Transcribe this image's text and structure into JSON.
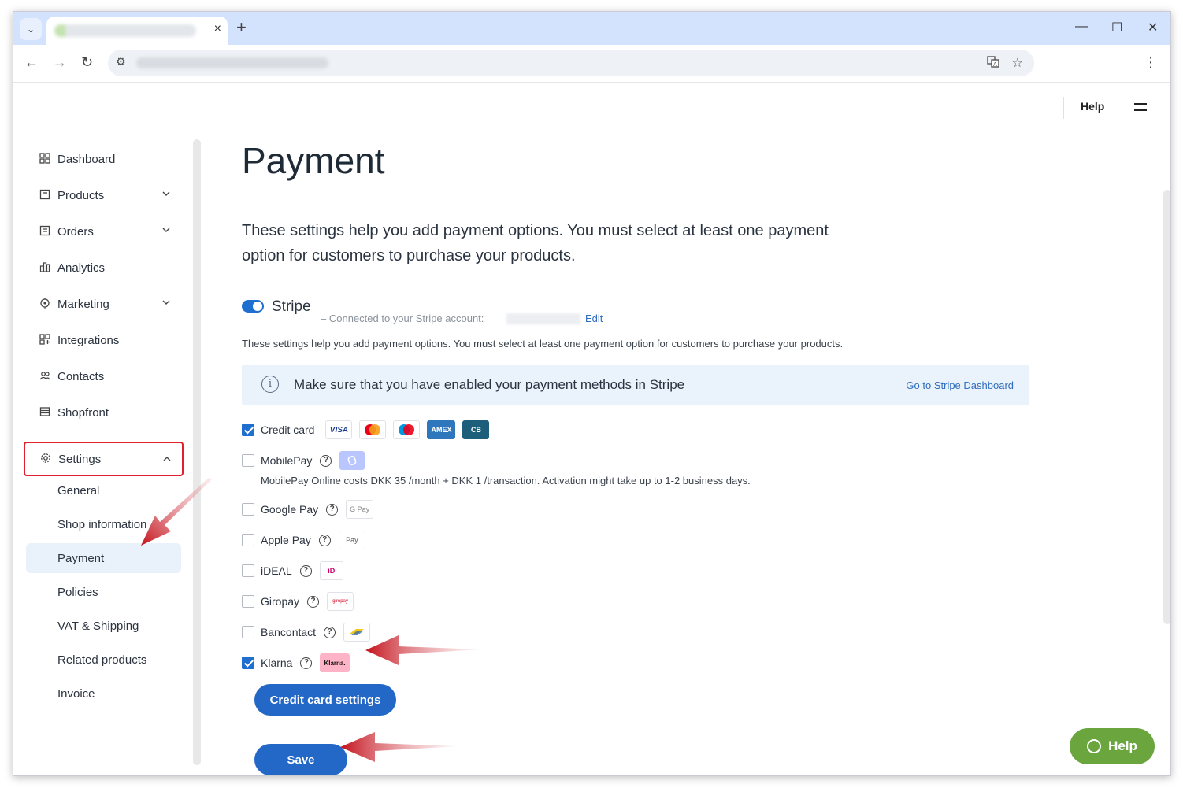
{
  "browser": {
    "tab_close": "×",
    "new_tab": "+",
    "min": "—",
    "max": "☐",
    "close": "✕",
    "back": "←",
    "forward": "→",
    "reload": "↻",
    "menu": "⋮"
  },
  "header": {
    "help_label": "Help"
  },
  "sidebar": {
    "items": [
      {
        "label": "Dashboard",
        "icon": "grid-icon"
      },
      {
        "label": "Products",
        "icon": "box-icon"
      },
      {
        "label": "Orders",
        "icon": "list-icon"
      },
      {
        "label": "Analytics",
        "icon": "bar-chart-icon"
      },
      {
        "label": "Marketing",
        "icon": "target-icon"
      },
      {
        "label": "Integrations",
        "icon": "plug-icon"
      },
      {
        "label": "Contacts",
        "icon": "people-icon"
      },
      {
        "label": "Shopfront",
        "icon": "store-icon"
      },
      {
        "label": "Settings",
        "icon": "gear-icon"
      }
    ],
    "settings_sub": [
      {
        "label": "General"
      },
      {
        "label": "Shop information"
      },
      {
        "label": "Payment"
      },
      {
        "label": "Policies"
      },
      {
        "label": "VAT & Shipping"
      },
      {
        "label": "Related products"
      },
      {
        "label": "Invoice"
      }
    ]
  },
  "main": {
    "title": "Payment",
    "lead": "These settings help you add payment options. You must select at least one payment option for customers to purchase your products.",
    "stripe": {
      "label": "Stripe",
      "connected": "– Connected to your Stripe account:",
      "edit": "Edit",
      "description": "These settings help you add payment options. You must select at least one payment option for customers to purchase your products."
    },
    "info": {
      "text": "Make sure that you have enabled your payment methods in Stripe",
      "link": "Go to Stripe Dashboard"
    },
    "methods": [
      {
        "label": "Credit card",
        "checked": true
      },
      {
        "label": "MobilePay",
        "checked": false
      },
      {
        "label": "Google Pay",
        "checked": false
      },
      {
        "label": "Apple Pay",
        "checked": false
      },
      {
        "label": "iDEAL",
        "checked": false
      },
      {
        "label": "Giropay",
        "checked": false
      },
      {
        "label": "Bancontact",
        "checked": false
      },
      {
        "label": "Klarna",
        "checked": true
      }
    ],
    "card_badges": [
      "VISA",
      "mastercard",
      "maestro",
      "AMEX",
      "CB"
    ],
    "badge_text": {
      "gpay": "G Pay",
      "applepay": "Pay",
      "ideal": "iD",
      "giropay": "giropay",
      "klarna": "Klarna."
    },
    "mobilepay_note": "MobilePay Online costs DKK 35 /month + DKK 1 /transaction. Activation might take up to 1-2 business days.",
    "credit_card_settings": "Credit card settings",
    "save": "Save"
  },
  "help_fab": "Help",
  "colors": {
    "accent": "#2367c7",
    "highlight": "#e0202a",
    "fab": "#6aa53e"
  }
}
